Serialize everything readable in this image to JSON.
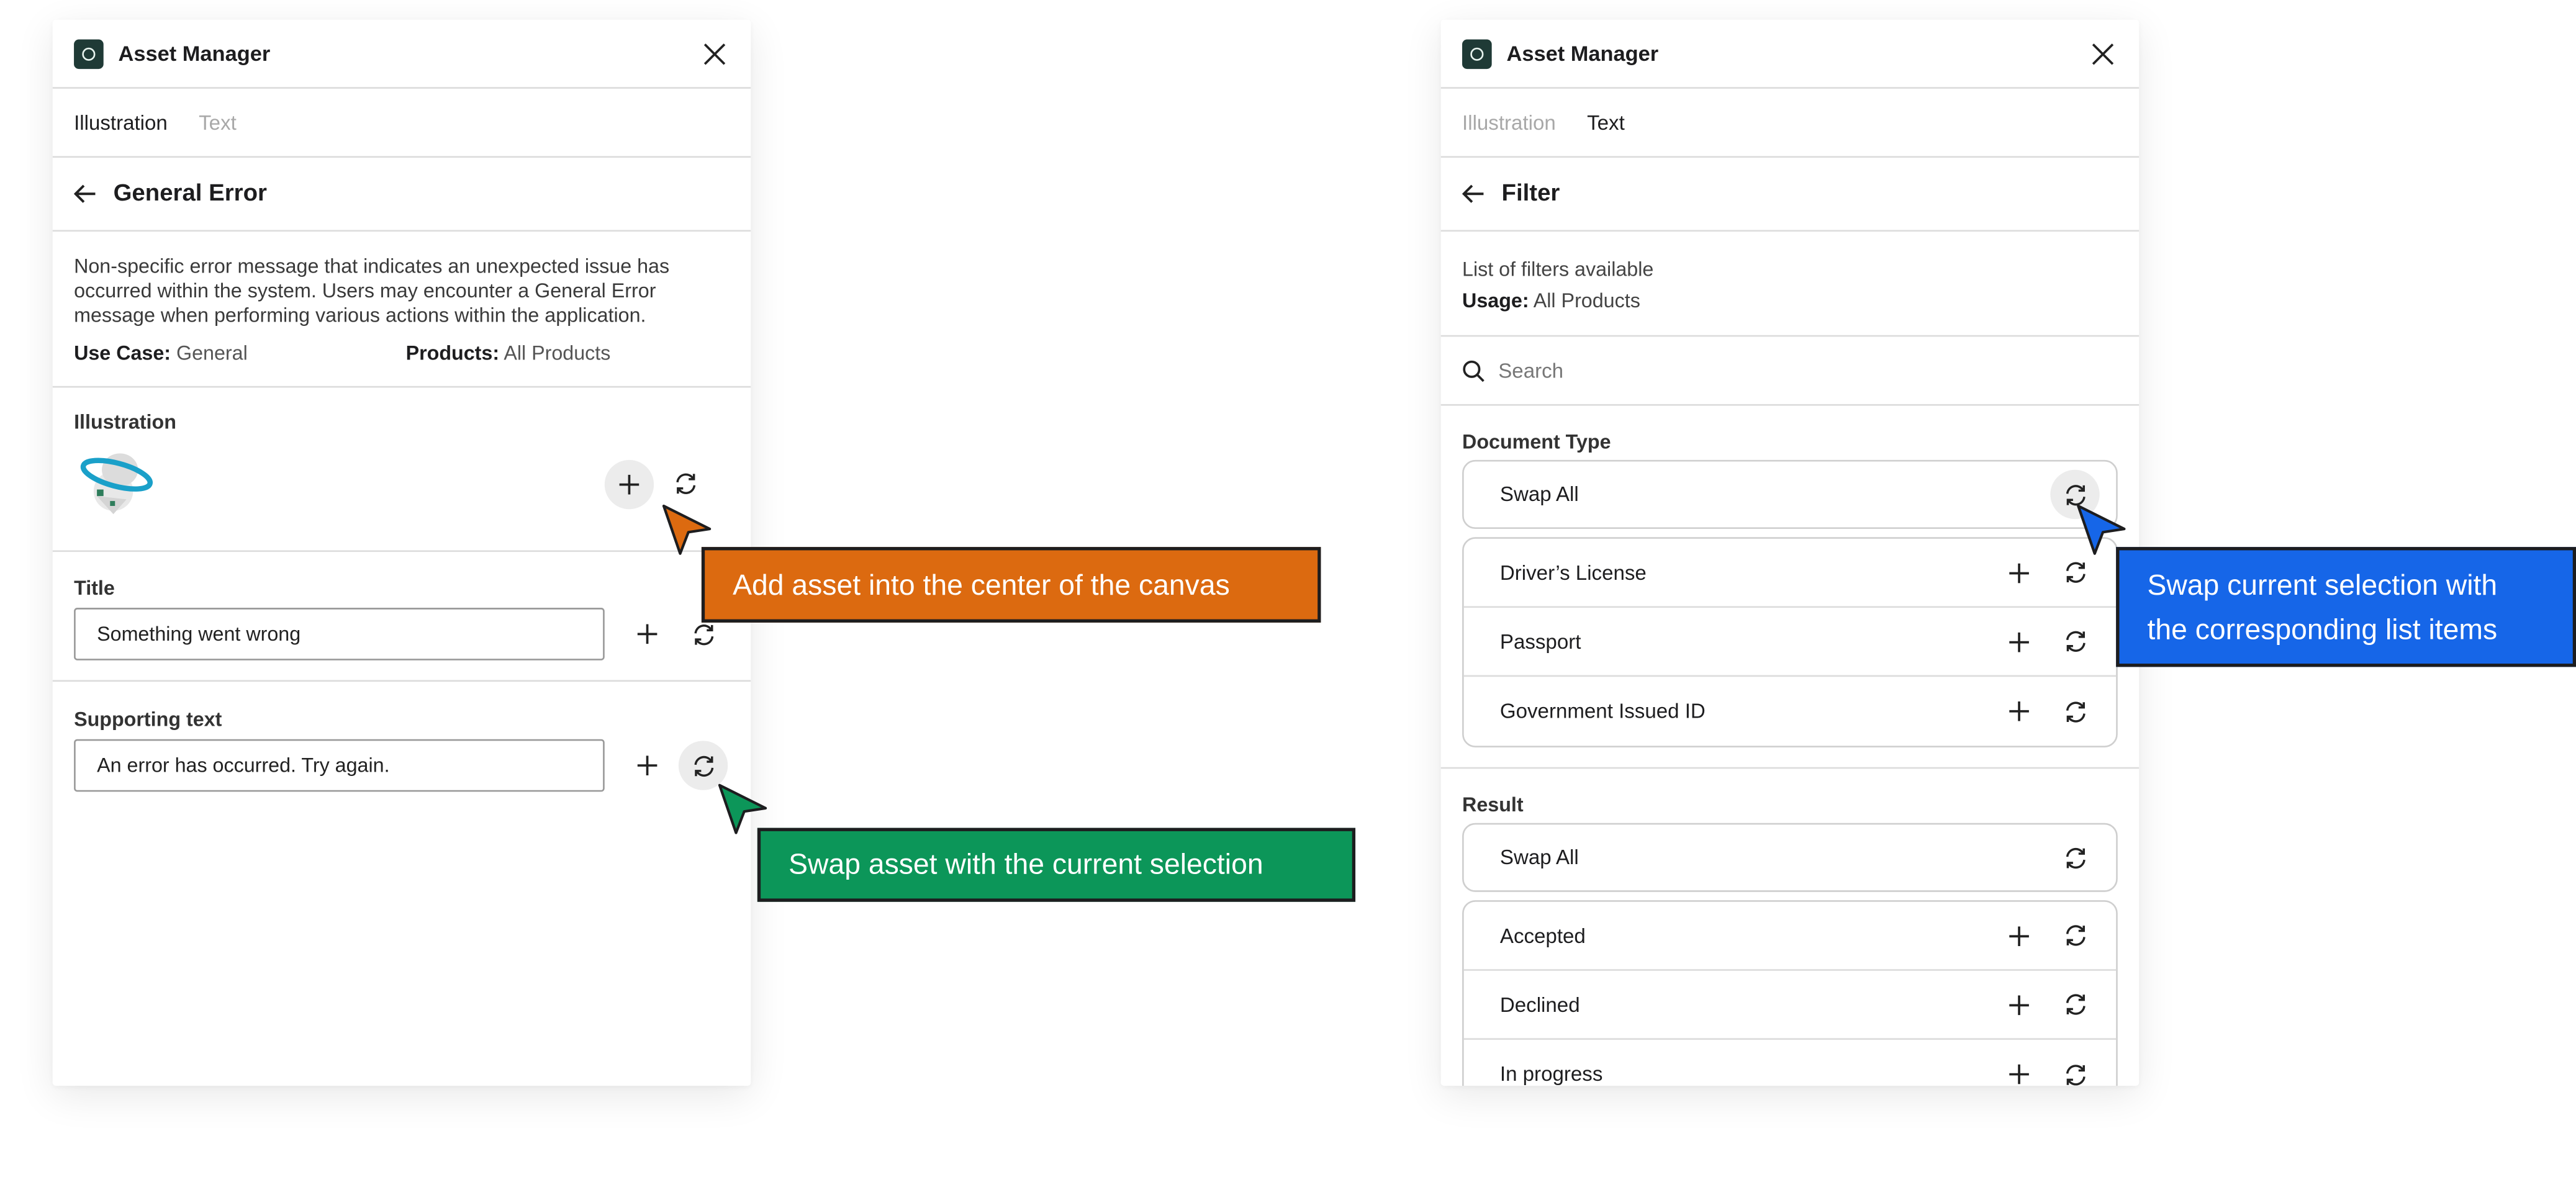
{
  "colors": {
    "orange": "#dc6a10",
    "green": "#0c9659",
    "blue": "#1666e8",
    "brand": "#1f3a36"
  },
  "left_panel": {
    "app_title": "Asset Manager",
    "tabs": [
      "Illustration",
      "Text"
    ],
    "active_tab": "Illustration",
    "page_title": "General Error",
    "description": "Non-specific error message that indicates an unexpected issue has occurred within the system. Users may encounter a General Error message when performing various actions within the application.",
    "use_case_label": "Use Case:",
    "use_case_value": "General",
    "products_label": "Products:",
    "products_value": "All Products",
    "illustration_label": "Illustration",
    "title_label": "Title",
    "title_value": "Something went wrong",
    "supporting_label": "Supporting text",
    "supporting_value": "An error has occurred. Try again."
  },
  "right_panel": {
    "app_title": "Asset Manager",
    "tabs": [
      "Illustration",
      "Text"
    ],
    "active_tab": "Text",
    "page_title": "Filter",
    "description": "List of filters available",
    "usage_label": "Usage:",
    "usage_value": "All Products",
    "search_placeholder": "Search",
    "groups": [
      {
        "label": "Document Type",
        "swap_all": "Swap All",
        "items": [
          "Driver’s License",
          "Passport",
          "Government Issued ID"
        ]
      },
      {
        "label": "Result",
        "swap_all": "Swap All",
        "items": [
          "Accepted",
          "Declined",
          "In progress"
        ]
      }
    ]
  },
  "callouts": {
    "add": "Add asset into the center of the canvas",
    "swap": "Swap asset with the current selection",
    "swap_list_line1": "Swap current selection with",
    "swap_list_line2": "the corresponding list items"
  },
  "icons": [
    "logo-icon",
    "close-icon",
    "back-arrow-icon",
    "plus-icon",
    "swap-icon",
    "search-icon",
    "ufo-illustration",
    "cursor-pointer"
  ]
}
